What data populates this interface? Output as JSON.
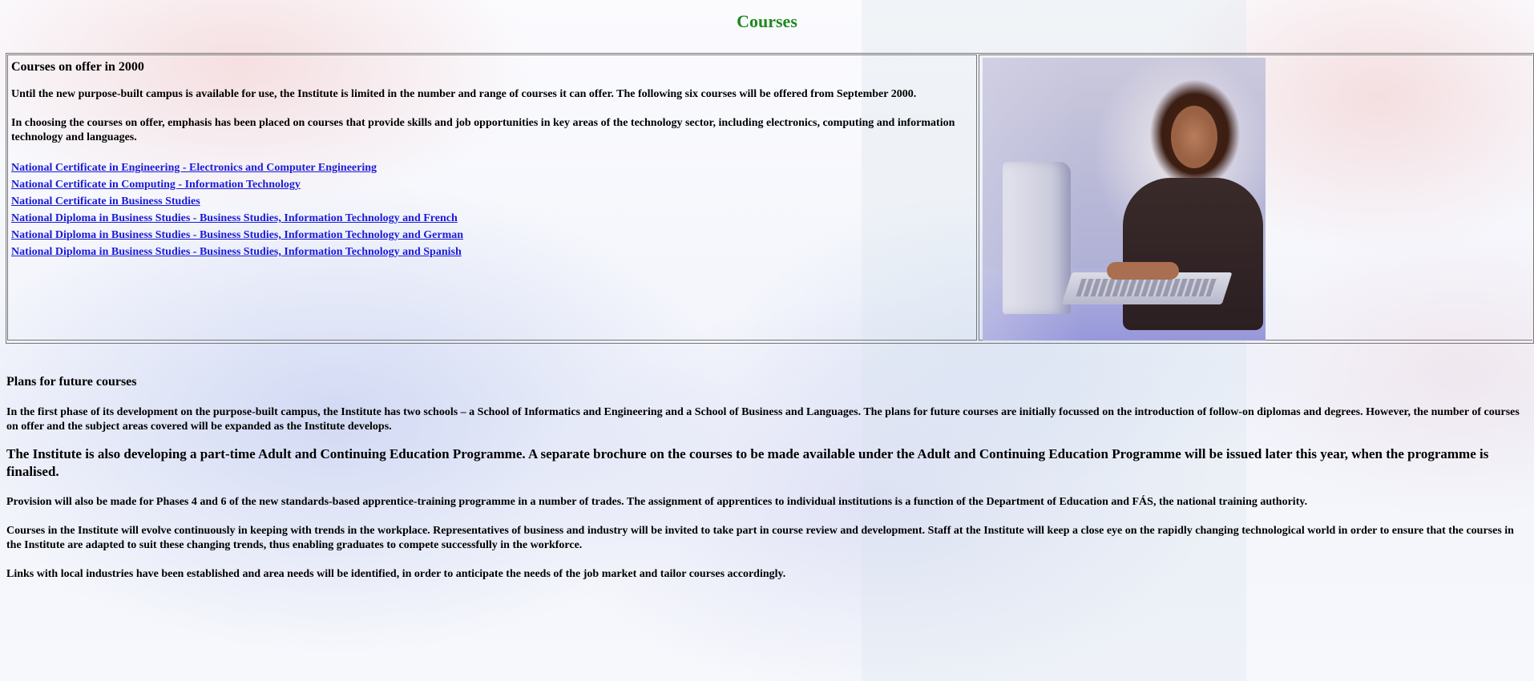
{
  "page": {
    "title": "Courses"
  },
  "offer": {
    "heading": "Courses on offer in 2000",
    "paragraph1": "Until the new purpose-built campus is available for use, the Institute is limited in the number and range of courses it can offer. The following six courses will be offered from September 2000.",
    "paragraph2": "In choosing the courses on offer, emphasis has been placed on courses that provide skills and job opportunities in key areas of the technology sector, including electronics, computing and information technology and languages.",
    "courses": [
      {
        "label": "National Certificate in Engineering - Electronics and Computer Engineering"
      },
      {
        "label": "National Certificate in Computing - Information Technology"
      },
      {
        "label": "National Certificate in Business Studies"
      },
      {
        "label": "National Diploma in Business Studies - Business Studies, Information Technology and French"
      },
      {
        "label": "National Diploma in Business Studies - Business Studies, Information Technology and German"
      },
      {
        "label": "National Diploma in Business Studies - Business Studies, Information Technology and Spanish"
      }
    ]
  },
  "future": {
    "heading": "Plans for future courses",
    "paragraph1": "In the first phase of its development on the purpose-built campus, the Institute has two schools – a School of Informatics and Engineering and a School of Business and Languages. The plans for future courses are initially focussed on the introduction of follow-on diplomas and degrees. However, the number of courses on offer and the subject areas covered will be expanded as the Institute develops.",
    "paragraph2": "The Institute is also developing a part-time Adult and Continuing Education Programme. A separate brochure on the courses to be made available under the Adult and Continuing Education Programme will be issued later this year, when the programme is finalised.",
    "paragraph3": "Provision will also be made for Phases 4 and 6 of the new standards-based apprentice-training programme in a number of trades. The assignment of apprentices to individual institutions is a function of the Department of Education and FÁS, the national training authority.",
    "paragraph4": "Courses in the Institute will evolve continuously in keeping with trends in the workplace. Representatives of business and industry will be invited to take part in course review and development. Staff at the Institute will keep a close eye on the rapidly changing technological world in order to ensure that the courses in the Institute are adapted to suit these changing trends, thus enabling graduates to compete successfully in the workforce.",
    "paragraph5": "Links with local industries have been established and area needs will be identified, in order to anticipate the needs of the job market and tailor courses accordingly."
  },
  "colors": {
    "title": "#1f8a1f",
    "link": "#1a1ad8"
  }
}
